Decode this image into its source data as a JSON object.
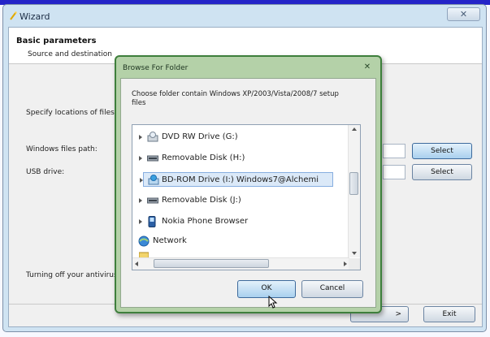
{
  "window": {
    "title": "Wizard",
    "close_glyph": "✕",
    "header_title": "Basic parameters",
    "header_subtitle": "Source and destination"
  },
  "main": {
    "specify_label": "Specify locations of files a",
    "windows_path_label": "Windows files path:",
    "usb_label": "USB drive:",
    "select_1": "Select",
    "select_2": "Select",
    "antivirus_label": "Turning off your antivirus",
    "next_glyph": ">",
    "exit_label": "Exit"
  },
  "dialog": {
    "title": "Browse For Folder",
    "close_glyph": "✕",
    "description": "Choose folder contain Windows XP/2003/Vista/2008/7 setup files",
    "items": [
      "DVD RW Drive (G:)",
      "Removable Disk (H:)",
      "BD-ROM Drive (I:) Windows7@Alchemi",
      "Removable Disk (J:)",
      "Nokia Phone Browser",
      "Network"
    ],
    "selected_index": 2,
    "ok_label": "OK",
    "cancel_label": "Cancel"
  },
  "colors": {
    "dialog_frame": "#3e7f3c",
    "select_button": "#a9d0ee",
    "selection": "#dbe9f8"
  }
}
